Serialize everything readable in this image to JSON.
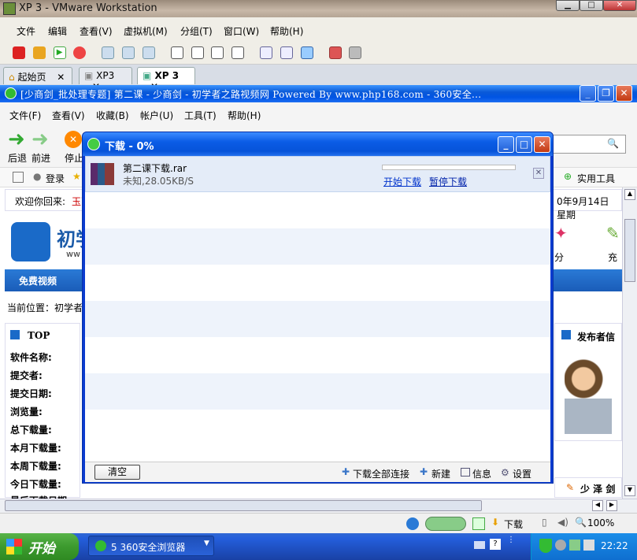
{
  "vmware": {
    "title": "XP 3 - VMware Workstation",
    "menu": [
      "文件",
      "编辑",
      "查看(V)",
      "虚拟机(M)",
      "分组(T)",
      "窗口(W)",
      "帮助(H)"
    ],
    "tabs": [
      {
        "label": "起始页",
        "active": false
      },
      {
        "label": "XP3",
        "active": false
      },
      {
        "label": "XP 3",
        "active": true
      }
    ],
    "close_glyph": "✕"
  },
  "browser": {
    "title": "[少商剑_批处理专题] 第二课 - 少商剑 - 初学者之路视频网 Powered By www.php168.com - 360安全...",
    "menu": [
      "文件(F)",
      "查看(V)",
      "收藏(B)",
      "帐户(U)",
      "工具(T)",
      "帮助(H)"
    ],
    "nav": {
      "back": "后退",
      "forward": "前进",
      "stop": "停止"
    },
    "favbar": {
      "login": "登录",
      "tools": "实用工具"
    },
    "page": {
      "welcome": "欢迎你回来:",
      "welcome_user": "玉面",
      "date": "0年9月14日 星期",
      "logo_text": "初学",
      "logo_sub": "ww",
      "free_video": "免费视频",
      "location": "当前位置：初学者",
      "top_label": "TOP",
      "fields": [
        "软件名称:",
        "提交者:",
        "提交日期:",
        "浏览量:",
        "总下载量:",
        "本月下载量:",
        "本周下载量:",
        "今日下载量:",
        "最后下载日期:"
      ],
      "publisher": "发布者信",
      "side_label": "分",
      "side_label2": "充",
      "friend": "少 泽 剑"
    },
    "status": {
      "download": "下载",
      "zoom": "100%"
    }
  },
  "dialog": {
    "title": "下载 - 0%",
    "item": {
      "filename": "第二课下载.rar",
      "info": "未知,28.05KB/S",
      "progress": 0,
      "start_link": "开始下载",
      "pause_link": "暂停下载"
    },
    "footer": {
      "clear": "清空",
      "download_all": "下载全部连接",
      "new": "新建",
      "info": "信息",
      "settings": "设置"
    }
  },
  "taskbar": {
    "start": "开始",
    "task": "5 360安全浏览器",
    "time": "22:22"
  }
}
